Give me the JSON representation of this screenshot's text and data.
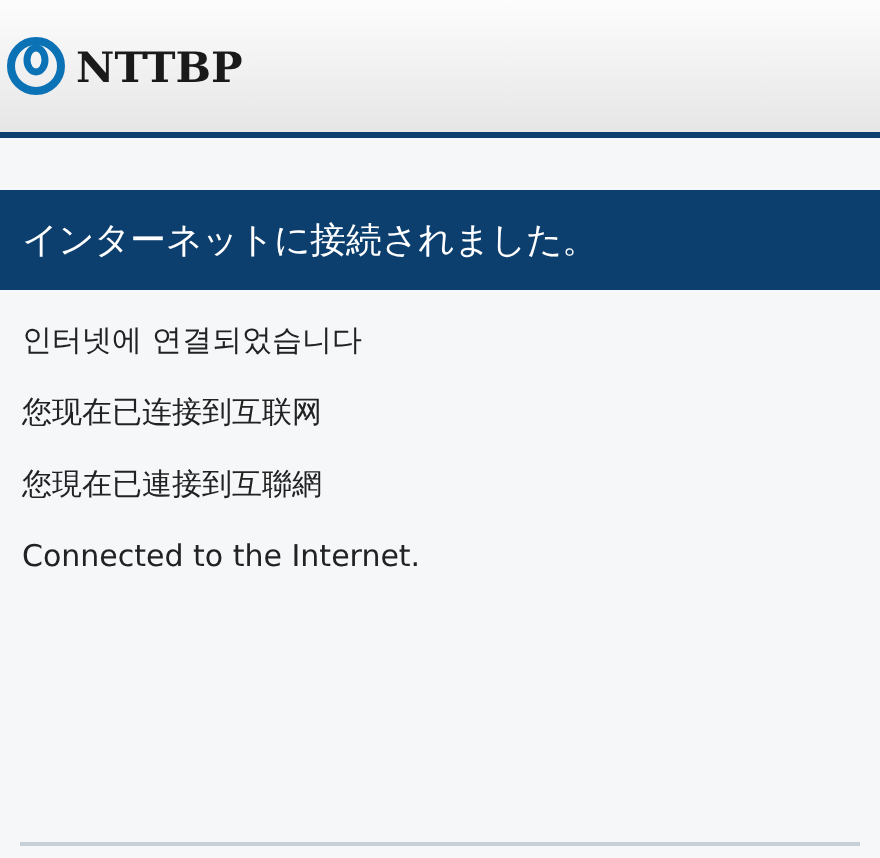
{
  "header": {
    "logo_text": "NTTBP"
  },
  "banner": {
    "title": "インターネットに接続されました。"
  },
  "messages": [
    "인터넷에 연결되었습니다",
    "您现在已连接到互联网",
    "您現在已連接到互聯網",
    "Connected to the Internet."
  ]
}
